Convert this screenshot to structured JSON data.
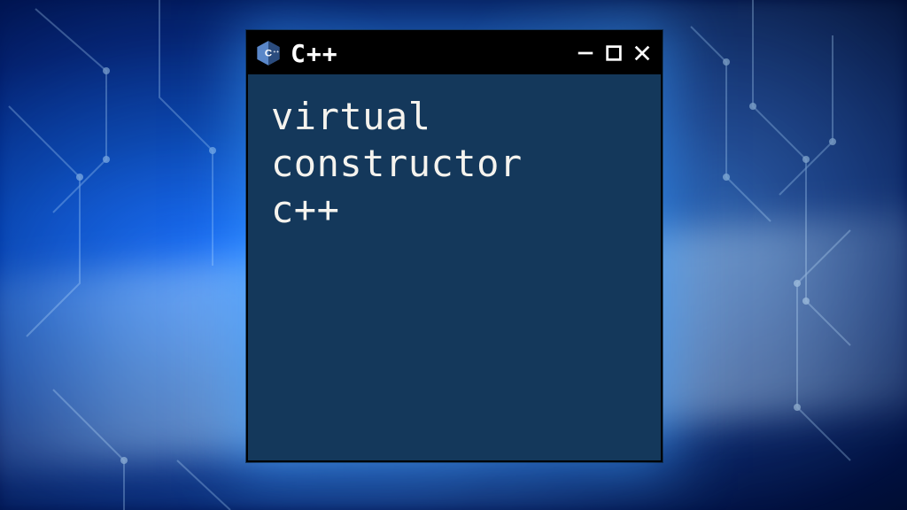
{
  "window": {
    "title": "C++",
    "content": "virtual\nconstructor\nc++"
  },
  "icons": {
    "logo": "cpp-logo",
    "minimize": "minimize",
    "maximize": "maximize",
    "close": "close"
  },
  "colors": {
    "window_bg": "#14385b",
    "titlebar_bg": "#000000",
    "text": "#f5f3ee",
    "logo_primary": "#4f79b8",
    "logo_dark": "#2b4c7e"
  }
}
